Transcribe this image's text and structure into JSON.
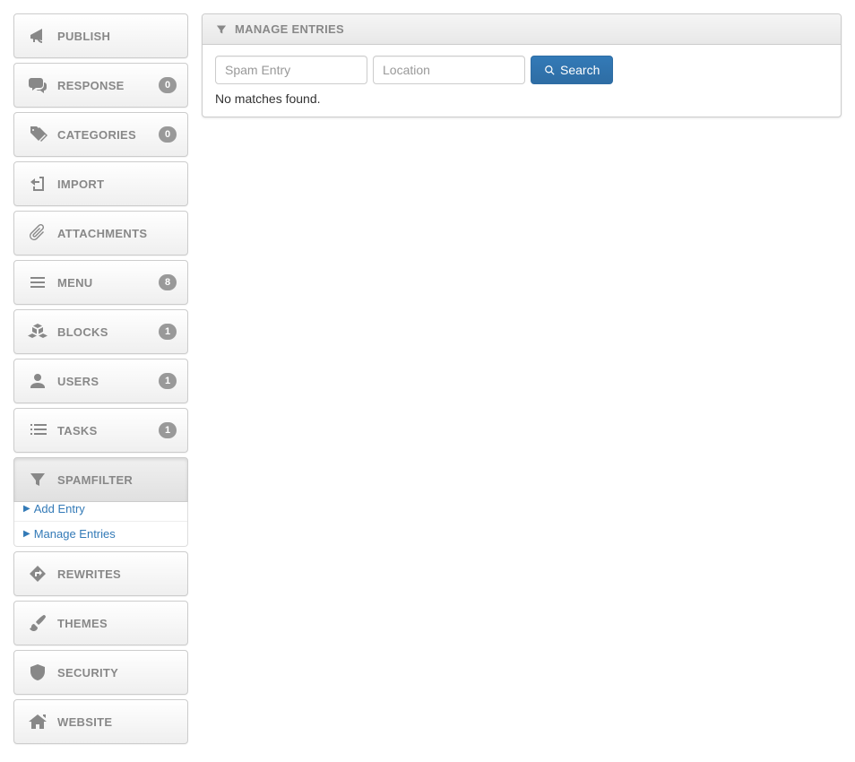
{
  "sidebar": {
    "items": [
      {
        "id": "publish",
        "label": "PUBLISH",
        "icon": "bullhorn",
        "badge": null
      },
      {
        "id": "response",
        "label": "RESPONSE",
        "icon": "comments",
        "badge": "0"
      },
      {
        "id": "categories",
        "label": "CATEGORIES",
        "icon": "tags",
        "badge": "0"
      },
      {
        "id": "import",
        "label": "IMPORT",
        "icon": "import",
        "badge": null
      },
      {
        "id": "attachments",
        "label": "ATTACHMENTS",
        "icon": "paperclip",
        "badge": null
      },
      {
        "id": "menu",
        "label": "MENU",
        "icon": "menu",
        "badge": "8"
      },
      {
        "id": "blocks",
        "label": "BLOCKS",
        "icon": "cubes",
        "badge": "1"
      },
      {
        "id": "users",
        "label": "USERS",
        "icon": "user",
        "badge": "1"
      },
      {
        "id": "tasks",
        "label": "TASKS",
        "icon": "tasks",
        "badge": "1"
      },
      {
        "id": "spamfilter",
        "label": "SPAMFILTER",
        "icon": "filter",
        "badge": null,
        "active": true,
        "sub": [
          {
            "label": "Add Entry"
          },
          {
            "label": "Manage Entries"
          }
        ]
      },
      {
        "id": "rewrites",
        "label": "REWRITES",
        "icon": "directions",
        "badge": null
      },
      {
        "id": "themes",
        "label": "THEMES",
        "icon": "brush",
        "badge": null
      },
      {
        "id": "security",
        "label": "SECURITY",
        "icon": "shield",
        "badge": null
      },
      {
        "id": "website",
        "label": "WEBSITE",
        "icon": "home",
        "badge": null
      }
    ]
  },
  "panel": {
    "title": "MANAGE ENTRIES",
    "search": {
      "spam_placeholder": "Spam Entry",
      "location_placeholder": "Location",
      "button_label": "Search"
    },
    "result_message": "No matches found."
  }
}
